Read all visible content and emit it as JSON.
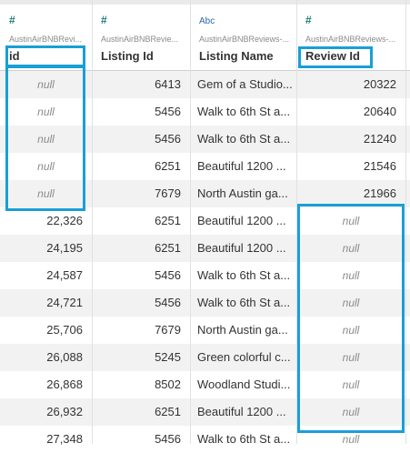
{
  "columns": [
    {
      "type_icon": "#",
      "source": "AustinAirBNBRevi...",
      "name": "id"
    },
    {
      "type_icon": "#",
      "source": "AustinAirBNBRevie...",
      "name": "Listing Id"
    },
    {
      "type_icon": "Abc",
      "source": "AustinAirBNBReviews-...",
      "name": "Listing Name"
    },
    {
      "type_icon": "#",
      "source": "AustinAirBNBReviews-...",
      "name": "Review Id"
    }
  ],
  "rows": [
    {
      "id": "null",
      "listing_id": "6413",
      "listing_name": "Gem of a Studio...",
      "review_id": "20322"
    },
    {
      "id": "null",
      "listing_id": "5456",
      "listing_name": "Walk to 6th St a...",
      "review_id": "20640"
    },
    {
      "id": "null",
      "listing_id": "5456",
      "listing_name": "Walk to 6th St a...",
      "review_id": "21240"
    },
    {
      "id": "null",
      "listing_id": "6251",
      "listing_name": "Beautiful 1200 ...",
      "review_id": "21546"
    },
    {
      "id": "null",
      "listing_id": "7679",
      "listing_name": "North Austin ga...",
      "review_id": "21966"
    },
    {
      "id": "22,326",
      "listing_id": "6251",
      "listing_name": "Beautiful 1200 ...",
      "review_id": "null"
    },
    {
      "id": "24,195",
      "listing_id": "6251",
      "listing_name": "Beautiful 1200 ...",
      "review_id": "null"
    },
    {
      "id": "24,587",
      "listing_id": "5456",
      "listing_name": "Walk to 6th St a...",
      "review_id": "null"
    },
    {
      "id": "24,721",
      "listing_id": "5456",
      "listing_name": "Walk to 6th St a...",
      "review_id": "null"
    },
    {
      "id": "25,706",
      "listing_id": "7679",
      "listing_name": "North Austin ga...",
      "review_id": "null"
    },
    {
      "id": "26,088",
      "listing_id": "5245",
      "listing_name": "Green colorful c...",
      "review_id": "null"
    },
    {
      "id": "26,868",
      "listing_id": "8502",
      "listing_name": "Woodland Studi...",
      "review_id": "null"
    },
    {
      "id": "26,932",
      "listing_id": "6251",
      "listing_name": "Beautiful 1200 ...",
      "review_id": "null"
    },
    {
      "id": "27,348",
      "listing_id": "5456",
      "listing_name": "Walk to 6th St a...",
      "review_id": "null"
    }
  ],
  "colors": {
    "highlight": "#199fd6",
    "null_text": "#8c8c8c",
    "alt_row": "#f2f2f2"
  }
}
